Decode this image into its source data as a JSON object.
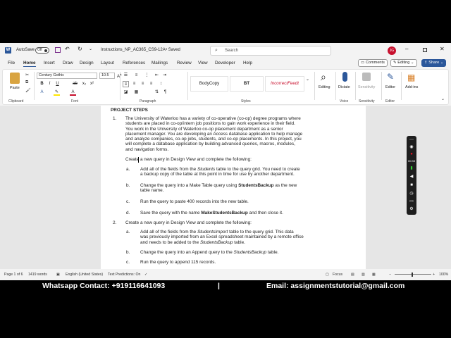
{
  "titlebar": {
    "autosave_label": "AutoSave",
    "autosave_state": "Off",
    "doc_title": "Instructions_NP_AC365_CS9-12A",
    "saved_status": "• Saved",
    "search_placeholder": "Search",
    "user_initials": "JG"
  },
  "menu": {
    "tabs": [
      "File",
      "Home",
      "Insert",
      "Draw",
      "Design",
      "Layout",
      "References",
      "Mailings",
      "Review",
      "View",
      "Developer",
      "Help"
    ],
    "active_tab": "Home",
    "comments_label": "Comments",
    "editing_label": "Editing",
    "share_label": "Share"
  },
  "ribbon": {
    "clipboard": {
      "paste_label": "Paste",
      "group_label": "Clipboard"
    },
    "font": {
      "font_name": "Century Gothic",
      "font_size": "10.5",
      "group_label": "Font"
    },
    "paragraph": {
      "group_label": "Paragraph"
    },
    "styles": {
      "items": [
        "BodyCopy",
        "BT",
        "IncorrectFeedt"
      ],
      "group_label": "Styles"
    },
    "editing": {
      "label": "Editing"
    },
    "voice": {
      "dictate_label": "Dictate",
      "group_label": "Voice"
    },
    "sensitivity": {
      "label": "Sensitivity",
      "group_label": "Sensitivity"
    },
    "editor": {
      "label": "Editor",
      "group_label": "Editor"
    },
    "addins": {
      "label": "Add-ins"
    }
  },
  "document": {
    "heading": "PROJECT STEPS",
    "item1": {
      "num": "1.",
      "lines": [
        "The University of Waterloo has a variety of co-operative (co-op) degree programs where",
        "students are placed in co-op/intern job positions to gain work experience in their field.",
        "You work in the University of Waterloo co-op placement department as a senior",
        "placement manager. You are developing an Access database application to help manage",
        "and analyze companies, co-op jobs, students, and co-op placements. In this project, you",
        "will complete a database application by building advanced queries, macros, modules,",
        "and navigation forms."
      ],
      "intro": "Create a new query in Design View and complete the following:",
      "subs": [
        {
          "letter": "a.",
          "pre": "Add all of the fields from the ",
          "em": "Students",
          "post": " table to the query grid. You need to create",
          "line2": "a backup copy of the table at this point in time for use by another department."
        },
        {
          "letter": "b.",
          "pre": "Change the query into a Make Table query using ",
          "strong": "StudentsBackup",
          "post": " as the new",
          "line2": "table name."
        },
        {
          "letter": "c.",
          "text": "Run the query to paste 400 records into the new table."
        },
        {
          "letter": "d.",
          "pre": "Save the query with the name ",
          "strong": "MakeStudentsBackup",
          "post": " and then close it."
        }
      ]
    },
    "item2": {
      "num": "2.",
      "intro": "Create a new query in Design View and complete the following:",
      "subs": [
        {
          "letter": "a.",
          "pre": "Add all of the fields from the ",
          "em": "StudentsImport",
          "post": " table to the query grid. This data",
          "line2": "was previously imported from an Excel spreadsheet maintained by a remote office",
          "line3pre": "and needs to be added to the ",
          "line3em": "StudentsBackup",
          "line3post": " table."
        },
        {
          "letter": "b.",
          "pre": "Change the query into an Append query to the ",
          "em": "StudentsBackup",
          "post": " table."
        },
        {
          "letter": "c.",
          "text": "Run the query to append 115 records."
        }
      ]
    }
  },
  "status": {
    "page": "Page 1 of 6",
    "words": "1419 words",
    "language": "English (United States)",
    "predictions": "Text Predictions: On",
    "focus": "Focus",
    "zoom": "100%"
  },
  "recorder": {
    "timer": "00:33"
  },
  "footer": {
    "whatsapp": "Whatsapp Contact: +919116641093",
    "separator": "|",
    "email": "Email: assignmentstutorial@gmail.com"
  },
  "colors": {
    "accent": "#2b579a",
    "avatar": "#c8102e",
    "record": "#e81123"
  }
}
